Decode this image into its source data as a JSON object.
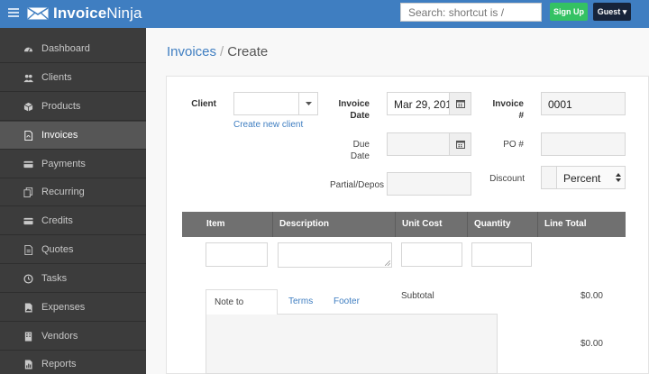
{
  "app": {
    "brand_bold": "Invoice",
    "brand_light": "Ninja",
    "search_placeholder": "Search: shortcut is /",
    "signup_label": "Sign Up",
    "guest_label": "Guest ▾"
  },
  "sidebar": {
    "items": [
      {
        "label": "Dashboard",
        "icon": "dashboard-icon"
      },
      {
        "label": "Clients",
        "icon": "users-icon"
      },
      {
        "label": "Products",
        "icon": "cube-icon"
      },
      {
        "label": "Invoices",
        "icon": "file-pdf-icon",
        "active": true
      },
      {
        "label": "Payments",
        "icon": "credit-card-icon"
      },
      {
        "label": "Recurring",
        "icon": "files-icon"
      },
      {
        "label": "Credits",
        "icon": "credit-card-icon"
      },
      {
        "label": "Quotes",
        "icon": "quote-icon"
      },
      {
        "label": "Tasks",
        "icon": "clock-icon"
      },
      {
        "label": "Expenses",
        "icon": "file-image-icon"
      },
      {
        "label": "Vendors",
        "icon": "building-icon"
      },
      {
        "label": "Reports",
        "icon": "report-icon"
      }
    ]
  },
  "breadcrumb": {
    "parent": "Invoices",
    "separator": "/",
    "current": "Create"
  },
  "form": {
    "client_label": "Client",
    "client_value": "",
    "create_client_link": "Create new client",
    "invoice_date_label": "Invoice Date",
    "invoice_date_value": "Mar 29, 201",
    "due_date_label": "Due Date",
    "due_date_value": "",
    "partial_label": "Partial/Depos",
    "partial_value": "",
    "invoice_number_label": "Invoice #",
    "invoice_number_value": "0001",
    "po_label": "PO #",
    "po_value": "",
    "discount_label": "Discount",
    "discount_value": "",
    "discount_type": "Percent"
  },
  "line_items": {
    "headers": [
      "Item",
      "Description",
      "Unit Cost",
      "Quantity",
      "Line Total"
    ]
  },
  "tabs": [
    "Note to Client",
    "Terms",
    "Footer"
  ],
  "totals": {
    "subtotal_label": "Subtotal",
    "subtotal_value": "$0.00",
    "second_value": "$0.00"
  },
  "colors": {
    "accent": "#3f7ec1",
    "sidebar": "#3c3c3c",
    "signup": "#34c263",
    "guest": "#17243a"
  }
}
